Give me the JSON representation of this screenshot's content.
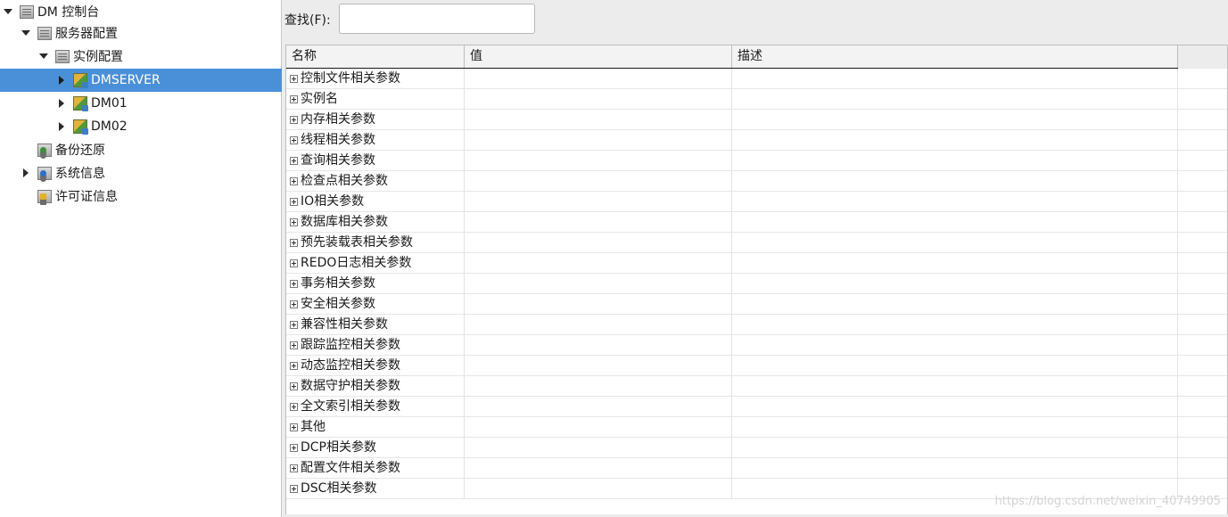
{
  "tree": {
    "root": "DM 控制台",
    "server_config": "服务器配置",
    "instance_config": "实例配置",
    "instances": [
      "DMSERVER",
      "DM01",
      "DM02"
    ],
    "backup": "备份还原",
    "system_info": "系统信息",
    "license": "许可证信息"
  },
  "search": {
    "label": "查找(F):",
    "value": ""
  },
  "grid": {
    "columns": [
      "名称",
      "值",
      "描述"
    ],
    "rows": [
      "控制文件相关参数",
      "实例名",
      "内存相关参数",
      "线程相关参数",
      "查询相关参数",
      "检查点相关参数",
      "IO相关参数",
      "数据库相关参数",
      "预先装载表相关参数",
      "REDO日志相关参数",
      "事务相关参数",
      "安全相关参数",
      "兼容性相关参数",
      "跟踪监控相关参数",
      "动态监控相关参数",
      "数据守护相关参数",
      "全文索引相关参数",
      "其他",
      "DCP相关参数",
      "配置文件相关参数",
      "DSC相关参数"
    ]
  },
  "watermark": "https://blog.csdn.net/weixin_40749905",
  "colors": {
    "selection": "#4a90d9",
    "panel_bg": "#ececec"
  }
}
